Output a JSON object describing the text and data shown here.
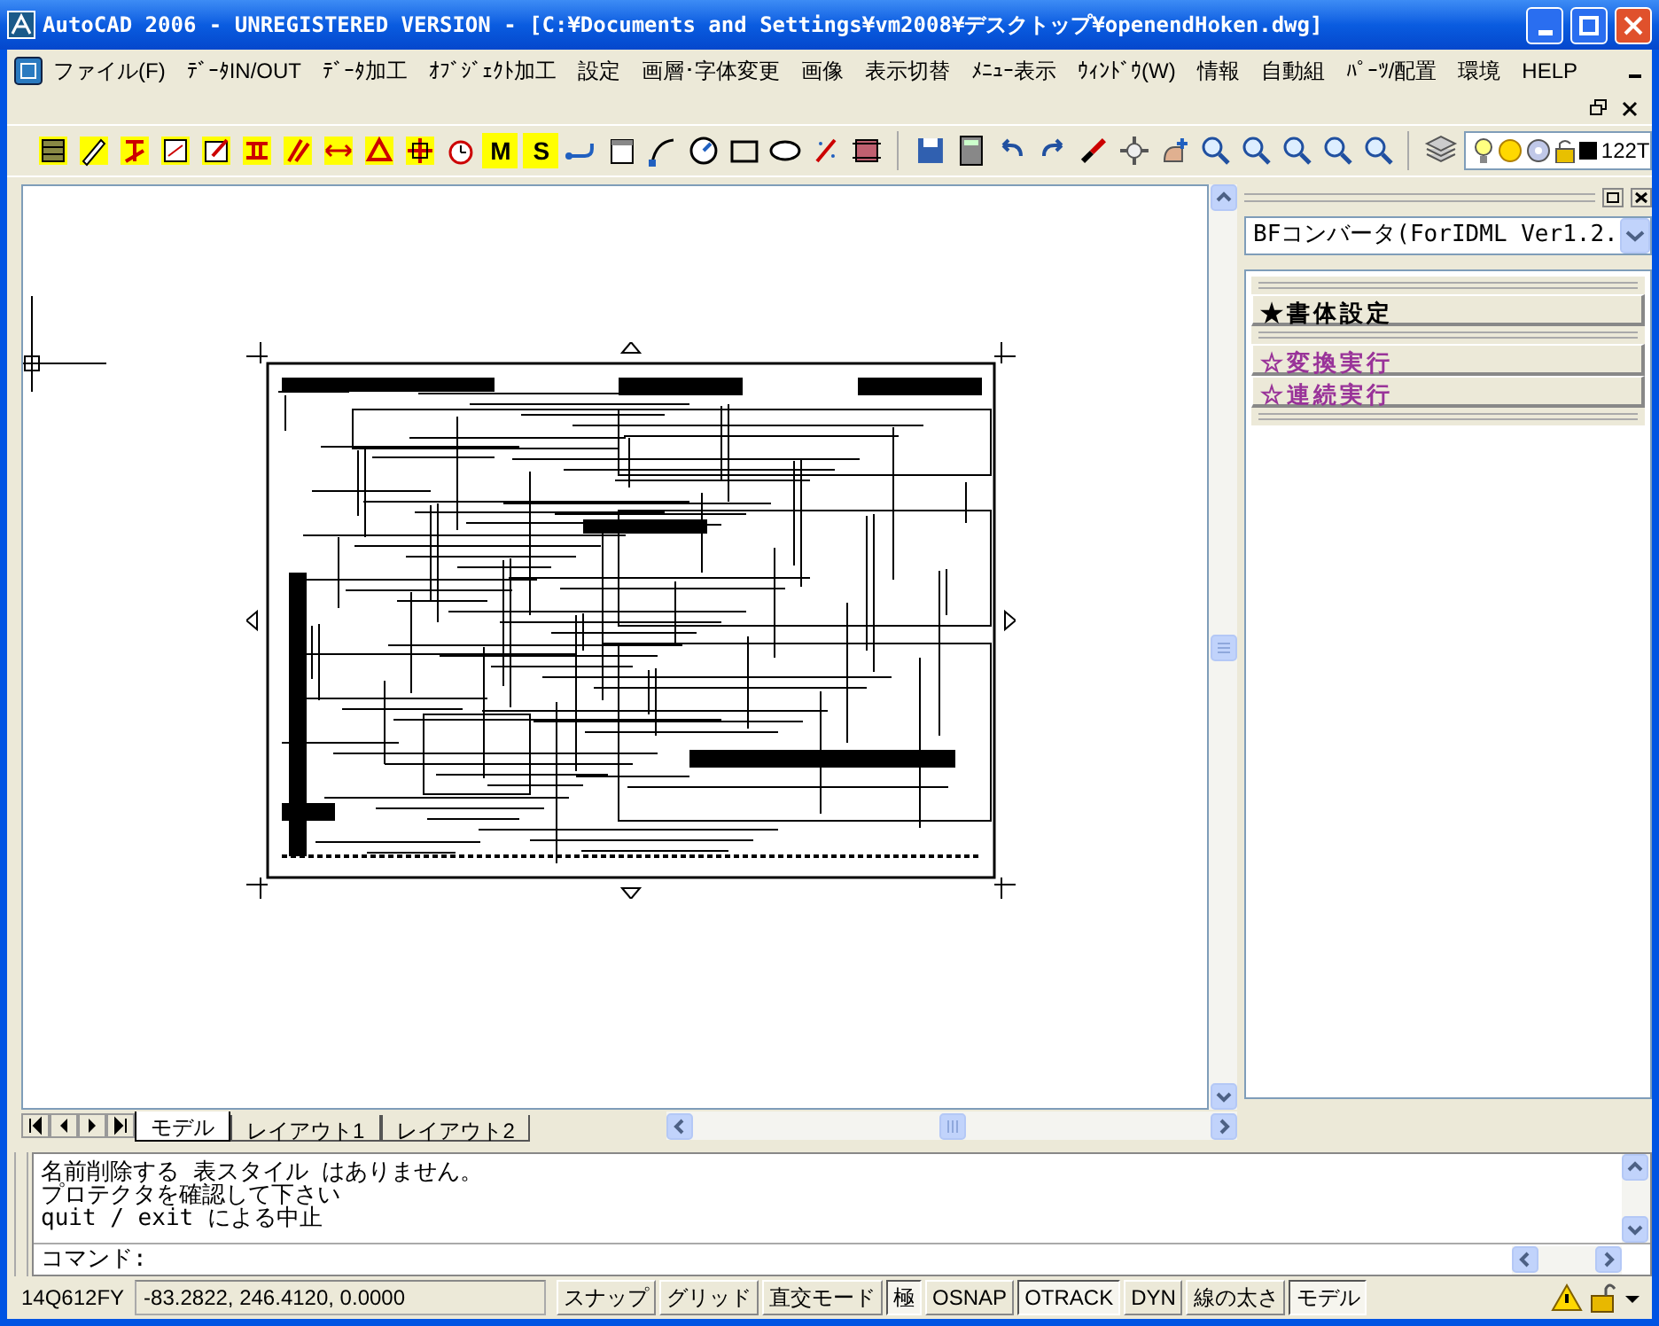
{
  "window": {
    "title": "AutoCAD 2006 - UNREGISTERED VERSION - [C:¥Documents and Settings¥vm2008¥デスクトップ¥openendHoken.dwg]"
  },
  "menu": [
    "ファイル(F)",
    "ﾃﾞｰﾀIN/OUT",
    "ﾃﾞｰﾀ加工",
    "ｵﾌﾞｼﾞｪｸﾄ加工",
    "設定",
    "画層･字体変更",
    "画像",
    "表示切替",
    "ﾒﾆｭｰ表示",
    "ｳｨﾝﾄﾞｳ(W)",
    "情報",
    "自動組",
    "ﾊﾟｰﾂ/配置",
    "環境",
    "HELP"
  ],
  "toolbar": {
    "letter_buttons": [
      "M",
      "S"
    ],
    "layer_name": "122T"
  },
  "side_panel": {
    "dropdown": "BFコンバータ(ForIDML Ver1.2.",
    "buttons": [
      {
        "label": "★書体設定",
        "color": "#000000"
      },
      {
        "label": "☆変換実行",
        "color": "#993399"
      },
      {
        "label": "☆連続実行",
        "color": "#993399"
      }
    ]
  },
  "layout_tabs": [
    {
      "label": "モデル",
      "selected": true
    },
    {
      "label": "レイアウト1",
      "selected": false
    },
    {
      "label": "レイアウト2",
      "selected": false
    }
  ],
  "command": {
    "history": [
      "名前削除する 表スタイル はありません。",
      "プロテクタを確認して下さい",
      "quit / exit による中止"
    ],
    "prompt": "コマンド:"
  },
  "status_bar": {
    "scale": "14Q612FY",
    "coordinates": "-83.2822, 246.4120, 0.0000",
    "toggles": [
      {
        "label": "スナップ",
        "on": false
      },
      {
        "label": "グリッド",
        "on": false
      },
      {
        "label": "直交モード",
        "on": false
      },
      {
        "label": "極",
        "on": true
      },
      {
        "label": "OSNAP",
        "on": false
      },
      {
        "label": "OTRACK",
        "on": true
      },
      {
        "label": "DYN",
        "on": false
      },
      {
        "label": "線の太さ",
        "on": false
      },
      {
        "label": "モデル",
        "on": true
      }
    ]
  }
}
